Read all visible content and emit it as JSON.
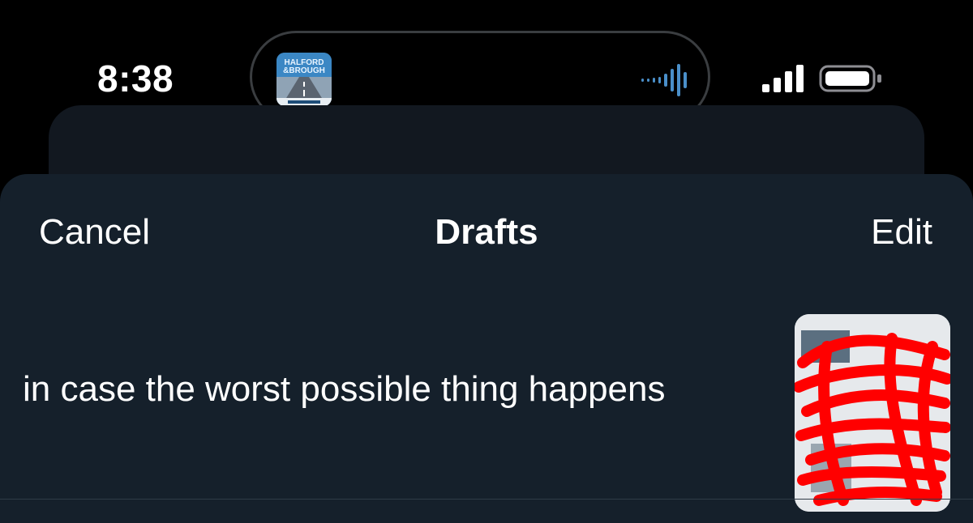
{
  "status_bar": {
    "time": "8:38",
    "live_activity": {
      "art_line1": "HALFORD",
      "art_line2": "&BROUGH",
      "icon": "waveform-icon",
      "waveform_color": "#4a8fc9"
    },
    "signal_icon": "cellular-signal-icon",
    "battery_icon": "battery-icon"
  },
  "nav": {
    "cancel_label": "Cancel",
    "title": "Drafts",
    "edit_label": "Edit"
  },
  "drafts": [
    {
      "text": "in case the worst possible thing happens",
      "thumbnail": "redacted-image-thumbnail"
    }
  ],
  "colors": {
    "sheet_background": "#15202b",
    "redaction": "#ff0000"
  }
}
